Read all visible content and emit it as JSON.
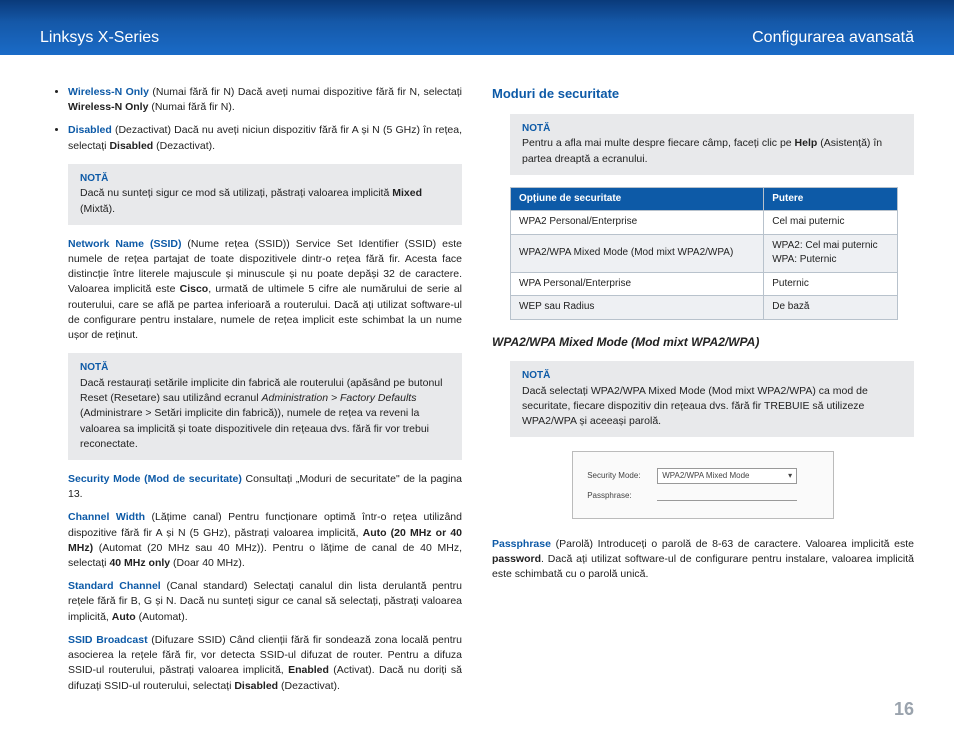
{
  "header": {
    "left": "Linksys X-Series",
    "right": "Configurarea avansată"
  },
  "left": {
    "bullets": [
      {
        "head": "Wireless-N Only",
        "text": "  (Numai fără fir N) Dacă aveți numai dispozitive fără fir N, selectați ",
        "bold1": "Wireless-N Only",
        "tail": " (Numai fără fir N)."
      },
      {
        "head": "Disabled",
        "text": "  (Dezactivat) Dacă nu aveți niciun dispozitiv fără fir A și N (5 GHz) în rețea, selectați ",
        "bold1": "Disabled",
        "tail": " (Dezactivat)."
      }
    ],
    "note1": {
      "title": "NOTĂ",
      "body_a": " Dacă nu sunteți sigur ce mod să utilizați, păstrați valoarea implicită ",
      "body_bold": "Mixed",
      "body_b": " (Mixtă)."
    },
    "ssid": {
      "head": "Network Name (SSID)",
      "body": " (Nume rețea (SSID)) Service Set Identifier (SSID) este numele de rețea partajat de toate dispozitivele dintr-o rețea fără fir. Acesta face distincție între literele majuscule și minuscule și nu poate depăși 32 de caractere. Valoarea implicită este ",
      "bold": "Cisco",
      "body2": ", urmată de ultimele 5 cifre ale numărului de serie al routerului, care se află pe partea inferioară a routerului. Dacă ați utilizat software-ul de configurare pentru instalare, numele de rețea implicit este schimbat la un nume ușor de reținut."
    },
    "note2": {
      "title": "NOTĂ",
      "body": "Dacă restaurați setările implicite din fabrică ale routerului (apăsând pe butonul Reset (Resetare) sau utilizând ecranul ",
      "italic": "Administration > Factory Defaults",
      "body2": " (Administrare > Setări implicite din fabrică)), numele de rețea va reveni la valoarea sa implicită și toate dispozitivele din rețeaua dvs. fără fir vor trebui reconectate."
    },
    "secmode": {
      "head": "Security Mode (Mod de securitate)",
      "body": "  Consultați „Moduri de securitate\" de la pagina 13."
    },
    "chwidth": {
      "head": "Channel Width",
      "body": "  (Lățime canal) Pentru funcționare optimă într-o rețea utilizând dispozitive fără fir A și N (5 GHz), păstrați valoarea implicită, ",
      "bold1": "Auto (20 MHz or 40 MHz)",
      "body2": " (Automat (20 MHz sau 40 MHz)). Pentru o lățime de canal de 40 MHz, selectați ",
      "bold2": "40 MHz only",
      "body3": " (Doar 40 MHz)."
    },
    "stdch": {
      "head": "Standard Channel",
      "body": " (Canal standard) Selectați canalul din lista derulantă pentru rețele fără fir B, G și N. Dacă nu sunteți sigur ce canal să selectați, păstrați valoarea implicită, ",
      "bold": "Auto",
      "body2": " (Automat)."
    },
    "ssidb": {
      "head": "SSID Broadcast",
      "body": " (Difuzare SSID) Când clienții fără fir sondează zona locală pentru asocierea la rețele fără fir, vor detecta SSID-ul difuzat de router. Pentru a difuza SSID-ul routerului, păstrați valoarea implicită, ",
      "bold1": "Enabled",
      "body2": " (Activat). Dacă nu doriți să difuzați SSID-ul routerului, selectați ",
      "bold2": "Disabled",
      "body3": " (Dezactivat)."
    }
  },
  "right": {
    "heading": "Moduri de securitate",
    "note1": {
      "title": "NOTĂ",
      "body_a": "Pentru a afla mai multe despre fiecare câmp, faceți clic pe ",
      "body_bold": "Help",
      "body_b": " (Asistență) în partea dreaptă a ecranului."
    },
    "table": {
      "headers": [
        "Opțiune de securitate",
        "Putere"
      ],
      "rows": [
        [
          "WPA2 Personal/Enterprise",
          "Cel mai puternic"
        ],
        [
          "WPA2/WPA Mixed Mode (Mod mixt WPA2/WPA)",
          "WPA2: Cel mai puternic\nWPA: Puternic"
        ],
        [
          "WPA Personal/Enterprise",
          "Puternic"
        ],
        [
          "WEP sau Radius",
          "De bază"
        ]
      ]
    },
    "subhead": "WPA2/WPA Mixed Mode (Mod mixt WPA2/WPA)",
    "note2": {
      "title": "NOTĂ",
      "body": "Dacă selectați WPA2/WPA Mixed Mode (Mod mixt WPA2/WPA) ca mod de securitate, fiecare dispozitiv din rețeaua dvs. fără fir TREBUIE să utilizeze WPA2/WPA și aceeași parolă."
    },
    "form": {
      "label1": "Security Mode:",
      "select": "WPA2/WPA Mixed Mode",
      "label2": "Passphrase:"
    },
    "pass": {
      "head": "Passphrase",
      "body": " (Parolă) Introduceți o parolă de 8-63 de caractere. Valoarea implicită este ",
      "bold": "password",
      "body2": ". Dacă ați utilizat software-ul de configurare pentru instalare, valoarea implicită este schimbată cu o parolă unică."
    }
  },
  "page_num": "16"
}
